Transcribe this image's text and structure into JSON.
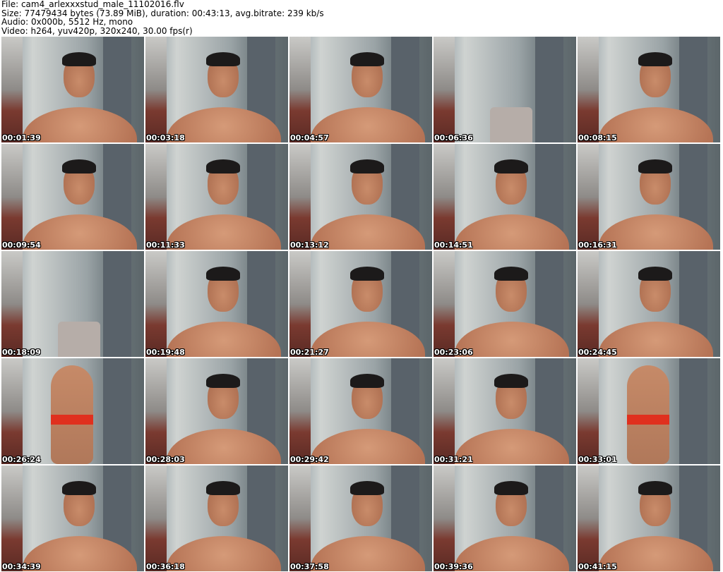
{
  "header": {
    "file": "File: cam4_arlexxxstud_male_11102016.flv",
    "size": "Size: 77479434 bytes (73.89 MiB), duration: 00:43:13, avg.bitrate: 239 kb/s",
    "audio": "Audio: 0x000b, 5512 Hz, mono",
    "video": "Video: h264, yuv420p, 320x240, 30.00 fps(r)"
  },
  "thumbnails": [
    {
      "time": "00:01:39",
      "scene": "face"
    },
    {
      "time": "00:03:18",
      "scene": "face"
    },
    {
      "time": "00:04:57",
      "scene": "face"
    },
    {
      "time": "00:06:36",
      "scene": "empty"
    },
    {
      "time": "00:08:15",
      "scene": "face"
    },
    {
      "time": "00:09:54",
      "scene": "face"
    },
    {
      "time": "00:11:33",
      "scene": "face"
    },
    {
      "time": "00:13:12",
      "scene": "face"
    },
    {
      "time": "00:14:51",
      "scene": "face"
    },
    {
      "time": "00:16:31",
      "scene": "face"
    },
    {
      "time": "00:18:09",
      "scene": "empty"
    },
    {
      "time": "00:19:48",
      "scene": "face"
    },
    {
      "time": "00:21:27",
      "scene": "face"
    },
    {
      "time": "00:23:06",
      "scene": "face"
    },
    {
      "time": "00:24:45",
      "scene": "face"
    },
    {
      "time": "00:26:24",
      "scene": "standing"
    },
    {
      "time": "00:28:03",
      "scene": "face"
    },
    {
      "time": "00:29:42",
      "scene": "face"
    },
    {
      "time": "00:31:21",
      "scene": "face"
    },
    {
      "time": "00:33:01",
      "scene": "standing"
    },
    {
      "time": "00:34:39",
      "scene": "face"
    },
    {
      "time": "00:36:18",
      "scene": "face"
    },
    {
      "time": "00:37:58",
      "scene": "face"
    },
    {
      "time": "00:39:36",
      "scene": "face"
    },
    {
      "time": "00:41:15",
      "scene": "face"
    }
  ]
}
